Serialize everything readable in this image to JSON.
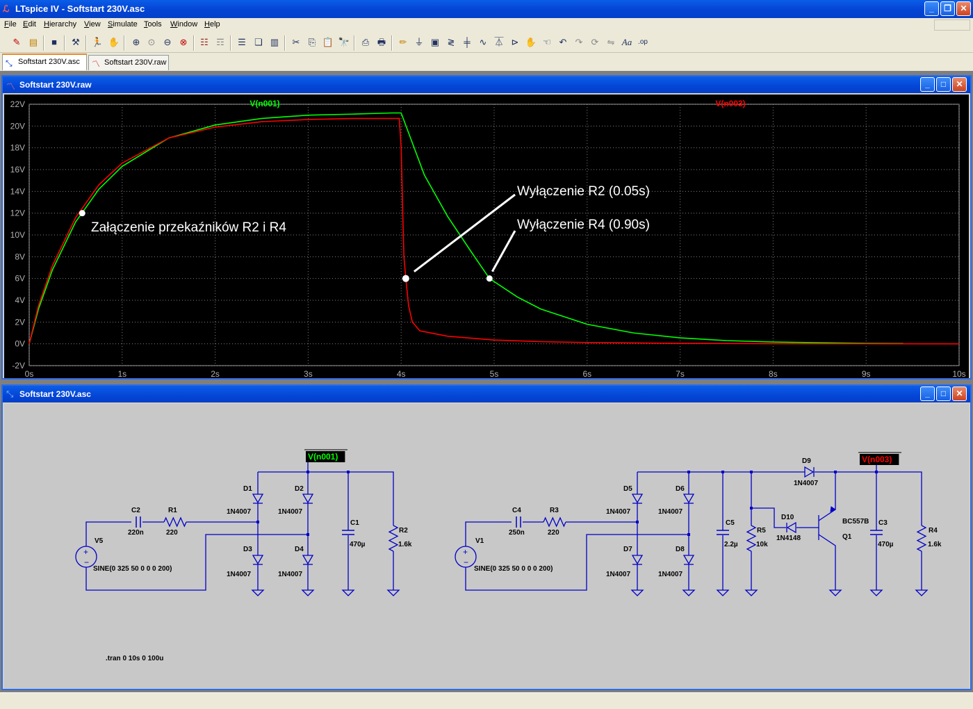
{
  "app": {
    "title": "LTspice IV - Softstart 230V.asc",
    "logo_icon": "ltspice-icon"
  },
  "menu": [
    "File",
    "Edit",
    "Hierarchy",
    "View",
    "Simulate",
    "Tools",
    "Window",
    "Help"
  ],
  "toolbar_icons": [
    "open-schematic-icon",
    "open-file-icon",
    "save-icon",
    "control-panel-icon",
    "run-icon",
    "halt-icon",
    "zoom-in-icon",
    "zoom-fit-icon",
    "zoom-out-icon",
    "cancel-zoom-icon",
    "autorange-icon",
    "fft-icon",
    "tile-horizontal-icon",
    "cascade-icon",
    "tile-vertical-icon",
    "cut-icon",
    "copy-icon",
    "paste-icon",
    "find-icon",
    "print-preview-icon",
    "print-icon",
    "draw-wire-icon",
    "ground-icon",
    "label-net-icon",
    "resistor-icon",
    "capacitor-icon",
    "inductor-icon",
    "diode-icon",
    "component-icon",
    "move-icon",
    "drag-icon",
    "undo-icon",
    "redo-icon",
    "rotate-icon",
    "mirror-icon",
    "text-icon",
    "spice-directive-icon"
  ],
  "tabs": [
    {
      "label": "Softstart 230V.asc",
      "icon": "schematic-icon",
      "active": true
    },
    {
      "label": "Softstart 230V.raw",
      "icon": "waveform-icon",
      "active": false
    }
  ],
  "waveform_window": {
    "title": "Softstart 230V.raw",
    "annotations": [
      {
        "text": "Załączenie przekaźników R2 i R4"
      },
      {
        "text": "Wyłączenie R2 (0.05s)"
      },
      {
        "text": "Wyłączenie R4 (0.90s)"
      }
    ]
  },
  "chart_data": {
    "type": "line",
    "xlim": [
      0,
      10
    ],
    "ylim": [
      -2,
      22
    ],
    "x_ticks": [
      "0s",
      "1s",
      "2s",
      "3s",
      "4s",
      "5s",
      "6s",
      "7s",
      "8s",
      "9s",
      "10s"
    ],
    "y_ticks": [
      "22V",
      "20V",
      "18V",
      "16V",
      "14V",
      "12V",
      "10V",
      "8V",
      "6V",
      "4V",
      "2V",
      "0V",
      "-2V"
    ],
    "background": "#000000",
    "series": [
      {
        "name": "V(n001)",
        "color": "#00ff00",
        "x": [
          0,
          0.1,
          0.25,
          0.5,
          0.75,
          1.0,
          1.5,
          2.0,
          2.5,
          3.0,
          3.5,
          3.9,
          4.0,
          4.25,
          4.5,
          4.75,
          4.95,
          5.25,
          5.5,
          6.0,
          6.5,
          7.0,
          7.5,
          8.0,
          8.5,
          9.0,
          9.4
        ],
        "y": [
          0,
          3.2,
          6.8,
          11.2,
          14.2,
          16.3,
          18.9,
          20.1,
          20.7,
          21.0,
          21.1,
          21.2,
          21.2,
          15.5,
          11.7,
          8.5,
          6.0,
          4.3,
          3.2,
          1.8,
          1.0,
          0.55,
          0.3,
          0.17,
          0.1,
          0.05,
          0.03
        ]
      },
      {
        "name": "V(n003)",
        "color": "#ff0000",
        "x": [
          0,
          0.1,
          0.25,
          0.5,
          0.75,
          1.0,
          1.5,
          2.0,
          2.5,
          3.0,
          3.5,
          3.98,
          4.0,
          4.02,
          4.03,
          4.05,
          4.08,
          4.12,
          4.2,
          4.5,
          5.0,
          5.5,
          6.0,
          7.0,
          8.0,
          9.0,
          10.0
        ],
        "y": [
          0,
          3.5,
          7.2,
          11.6,
          14.6,
          16.6,
          18.9,
          19.9,
          20.4,
          20.6,
          20.7,
          20.7,
          18.0,
          11.0,
          8.0,
          6.0,
          3.5,
          2.0,
          1.2,
          0.7,
          0.35,
          0.2,
          0.12,
          0.05,
          0.02,
          0.01,
          0.0
        ]
      }
    ],
    "markers": [
      {
        "x": 0.57,
        "y": 12.0
      },
      {
        "x": 4.05,
        "y": 6.0
      },
      {
        "x": 4.95,
        "y": 6.0
      }
    ]
  },
  "schematic_window": {
    "title": "Softstart 230V.asc",
    "net_labels": [
      "V(n001)",
      "V(n003)"
    ],
    "components": [
      {
        "ref": "C2",
        "value": "220n"
      },
      {
        "ref": "R1",
        "value": "220"
      },
      {
        "ref": "V5",
        "value": "SINE(0 325 50 0 0 0 200)"
      },
      {
        "ref": "D1",
        "value": "1N4007"
      },
      {
        "ref": "D2",
        "value": "1N4007"
      },
      {
        "ref": "D3",
        "value": "1N4007"
      },
      {
        "ref": "D4",
        "value": "1N4007"
      },
      {
        "ref": "C1",
        "value": "470µ"
      },
      {
        "ref": "R2",
        "value": "1.6k"
      },
      {
        "ref": "C4",
        "value": "250n"
      },
      {
        "ref": "R3",
        "value": "220"
      },
      {
        "ref": "V1",
        "value": "SINE(0 325 50 0 0 0 200)"
      },
      {
        "ref": "D5",
        "value": "1N4007"
      },
      {
        "ref": "D6",
        "value": "1N4007"
      },
      {
        "ref": "D7",
        "value": "1N4007"
      },
      {
        "ref": "D8",
        "value": "1N4007"
      },
      {
        "ref": "C5",
        "value": "2.2µ"
      },
      {
        "ref": "R5",
        "value": "10k"
      },
      {
        "ref": "D10",
        "value": "1N4148"
      },
      {
        "ref": "D9",
        "value": "1N4007"
      },
      {
        "ref": "Q1",
        "value": "BC557B"
      },
      {
        "ref": "C3",
        "value": "470µ"
      },
      {
        "ref": "R4",
        "value": "1.6k"
      }
    ],
    "directive": ".tran 0 10s 0 100u"
  },
  "colors": {
    "titlebar": "#0545d6",
    "wire": "#0000c8",
    "schematic_bg": "#c8c8c8",
    "label_green": "#00ff00",
    "label_red": "#ff0000"
  }
}
